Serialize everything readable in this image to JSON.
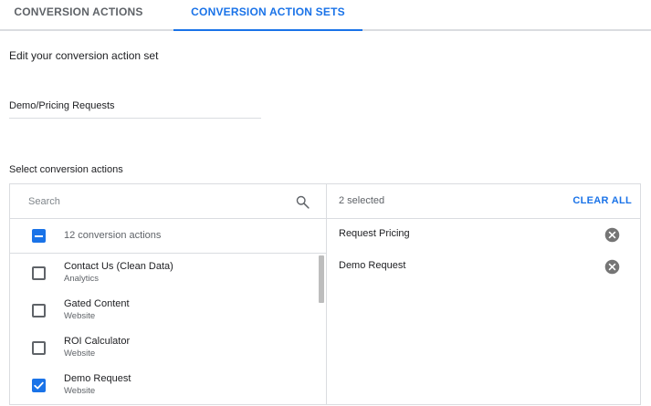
{
  "tabs": [
    {
      "label": "CONVERSION ACTIONS",
      "active": false
    },
    {
      "label": "CONVERSION ACTION SETS",
      "active": true
    }
  ],
  "form": {
    "heading": "Edit your conversion action set",
    "name_value": "Demo/Pricing Requests",
    "select_label": "Select conversion actions"
  },
  "search": {
    "placeholder": "Search",
    "icon": "search-icon"
  },
  "list": {
    "all_label": "12 conversion actions",
    "all_state": "indeterminate",
    "items": [
      {
        "title": "Contact Us (Clean Data)",
        "source": "Analytics",
        "checked": false
      },
      {
        "title": "Gated Content",
        "source": "Website",
        "checked": false
      },
      {
        "title": "ROI Calculator",
        "source": "Website",
        "checked": false
      },
      {
        "title": "Demo Request",
        "source": "Website",
        "checked": true
      }
    ]
  },
  "selected": {
    "count_label": "2 selected",
    "clear_label": "CLEAR ALL",
    "items": [
      {
        "label": "Request Pricing",
        "icon": "remove-icon"
      },
      {
        "label": "Demo Request",
        "icon": "remove-icon"
      }
    ]
  },
  "colors": {
    "accent": "#1a73e8",
    "text_secondary": "#5f6368",
    "divider": "#dadce0",
    "remove_icon": "#757575"
  }
}
